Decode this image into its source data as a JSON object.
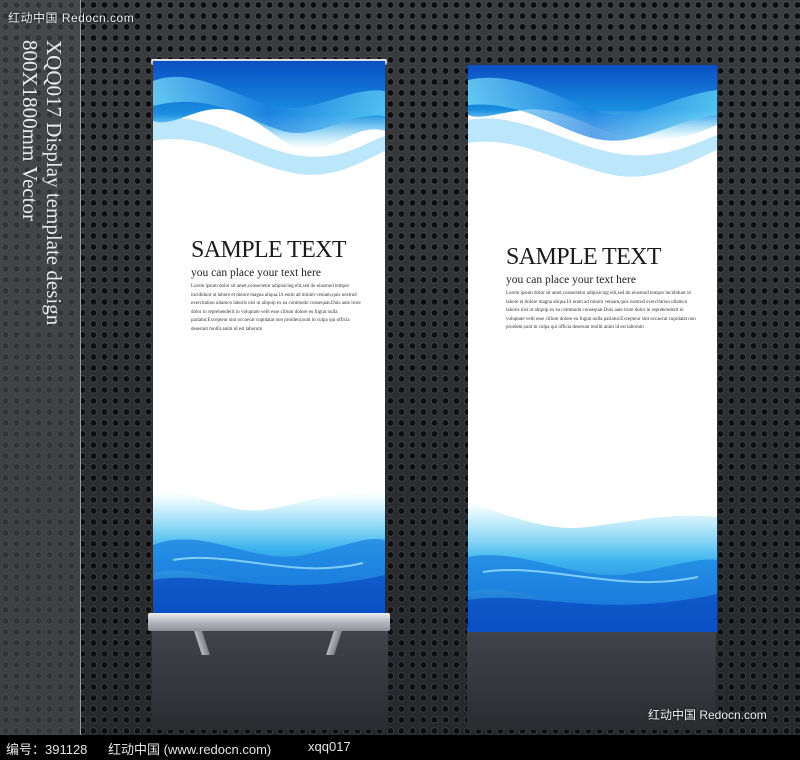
{
  "watermark": {
    "top": "红动中国 Redocn.com",
    "bottom": "红动中国 Redocn.com"
  },
  "side_title": "XQQ017 Display template design\n800X1800mm Vector",
  "banners": [
    {
      "heading": "SAMPLE TEXT",
      "subheading": "you can place your text here",
      "body": "Lorem ipsum dolor sit amet,consectetur adipisicing elit,sed do eiusmod tempor incididunt ut labore et dolore magna aliqua.Ut enim ad minim veniam,quis nostrud exercitation ullamco laboris nisi ut aliquip ex ea commodo consequat.Duis aute irure dolor in reprehenderit in voluptate velit esse cillum dolore eu fugiat nulla pariatur.Excepteur sint occaecat cupidatat non proident,sunt in culpa qui officia deserunt mollit anim id est laborum"
    },
    {
      "heading": "SAMPLE TEXT",
      "subheading": "you can place your text here",
      "body": "Lorem ipsum dolor sit amet,consectetur adipisicing elit,sed do eiusmod tempor incididunt ut labore et dolore magna aliqua.Ut enim ad minim veniam,quis nostrud exercitation ullamco laboris nisi ut aliquip ex ea commodo consequat.Duis aute irure dolor in reprehenderit in voluptate velit esse cillum dolore eu fugiat nulla pariatur.Excepteur sint occaecat cupidatat non proident,sunt in culpa qui officia deserunt mollit anim id est laborum"
    }
  ],
  "footer": {
    "id_text": "编号：391128",
    "site_text": "红动中国 (www.redocn.com)",
    "code_text": "xqq017"
  },
  "colors": {
    "wave_dark": "#0a4fc4",
    "wave_mid": "#1a8fe0",
    "wave_light": "#5fd3f5",
    "background": "#2d2f33"
  }
}
